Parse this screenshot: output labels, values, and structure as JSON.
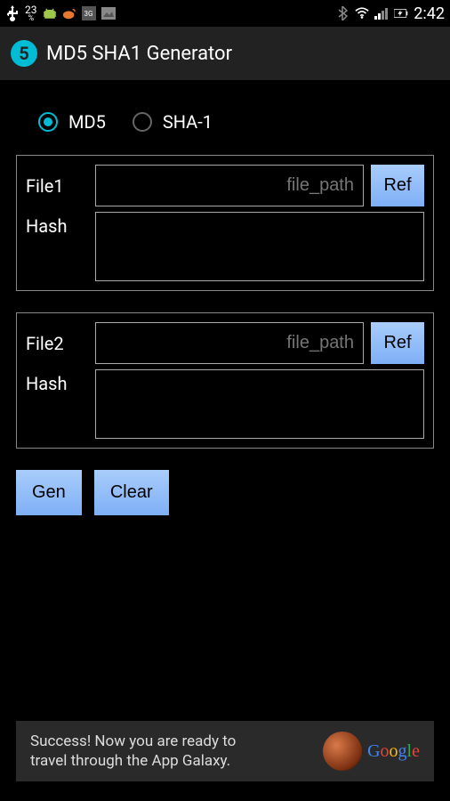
{
  "status_bar": {
    "battery_pct": "23",
    "network_label": "3G",
    "time": "2:42"
  },
  "app": {
    "icon_num": "5",
    "title": "MD5 SHA1 Generator"
  },
  "algo": {
    "md5_label": "MD5",
    "sha1_label": "SHA-1"
  },
  "file1": {
    "label": "File1",
    "placeholder": "file_path",
    "ref_label": "Ref",
    "hash_label": "Hash"
  },
  "file2": {
    "label": "File2",
    "placeholder": "file_path",
    "ref_label": "Ref",
    "hash_label": "Hash"
  },
  "buttons": {
    "gen": "Gen",
    "clear": "Clear"
  },
  "ad": {
    "line1": "Success! Now you are ready to",
    "line2": "travel through the App Galaxy.",
    "brand": "Google"
  }
}
